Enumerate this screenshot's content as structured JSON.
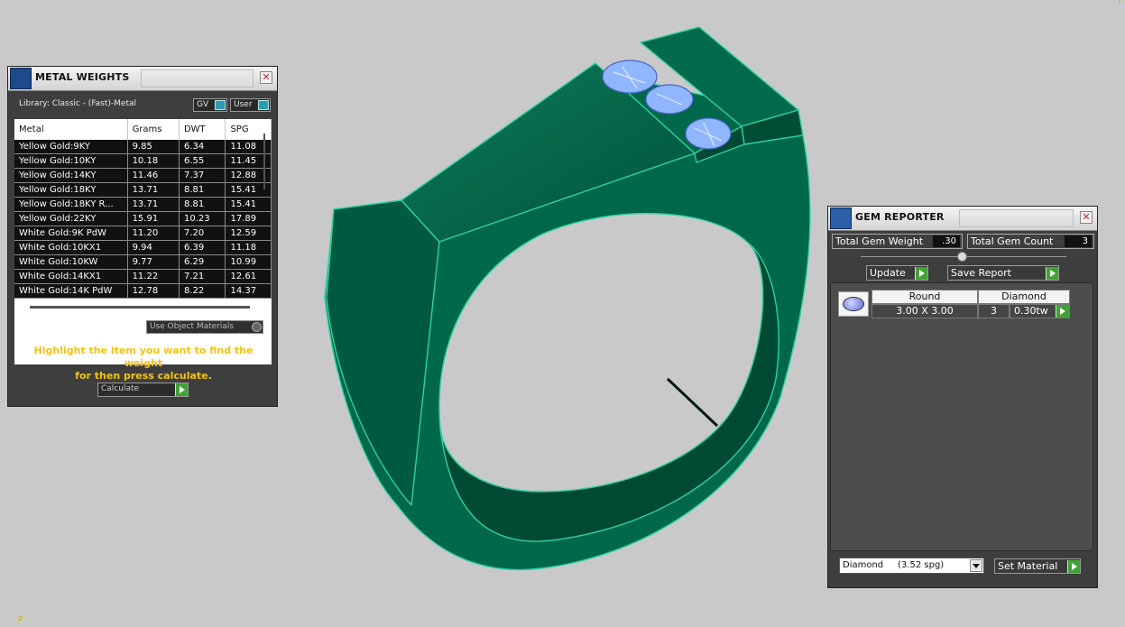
{
  "metal_weights": {
    "title": "METAL WEIGHTS",
    "library_label": "Library: Classic - (Fast)-Metal",
    "toggle_gv": "GV",
    "toggle_user": "User",
    "columns": [
      "Metal",
      "Grams",
      "DWT",
      "SPG"
    ],
    "rows": [
      [
        "Yellow Gold:9KY",
        "9.85",
        "6.34",
        "11.08"
      ],
      [
        "Yellow Gold:10KY",
        "10.18",
        "6.55",
        "11.45"
      ],
      [
        "Yellow Gold:14KY",
        "11.46",
        "7.37",
        "12.88"
      ],
      [
        "Yellow Gold:18KY",
        "13.71",
        "8.81",
        "15.41"
      ],
      [
        "Yellow Gold:18KY R...",
        "13.71",
        "8.81",
        "15.41"
      ],
      [
        "Yellow Gold:22KY",
        "15.91",
        "10.23",
        "17.89"
      ],
      [
        "White Gold:9K PdW",
        "11.20",
        "7.20",
        "12.59"
      ],
      [
        "White Gold:10KX1",
        "9.94",
        "6.39",
        "11.18"
      ],
      [
        "White Gold:10KW",
        "9.77",
        "6.29",
        "10.99"
      ],
      [
        "White Gold:14KX1",
        "11.22",
        "7.21",
        "12.61"
      ],
      [
        "White Gold:14K PdW",
        "12.78",
        "8.22",
        "14.37"
      ]
    ],
    "use_object_materials": "Use Object Materials",
    "hint_line1": "Highlight the item you want to find the weight",
    "hint_line2": "for then press calculate.",
    "calculate_label": "Calculate"
  },
  "gem_reporter": {
    "title": "GEM REPORTER",
    "total_weight_label": "Total Gem Weight",
    "total_weight_value": ".30",
    "total_count_label": "Total Gem Count",
    "total_count_value": "3",
    "update_label": "Update",
    "save_report_label": "Save Report",
    "gem": {
      "shape": "Round",
      "material": "Diamond",
      "size": "3.00 X 3.00",
      "count": "3",
      "weight": "0.30tw"
    },
    "material_select": "Diamond     (3.52 spg)",
    "set_material_label": "Set Material"
  },
  "colors": {
    "ring_green": "#00684a",
    "ring_edge": "#2fd0a3",
    "gem_blue": "#8fb6ff",
    "background": "#c9c9c9"
  }
}
